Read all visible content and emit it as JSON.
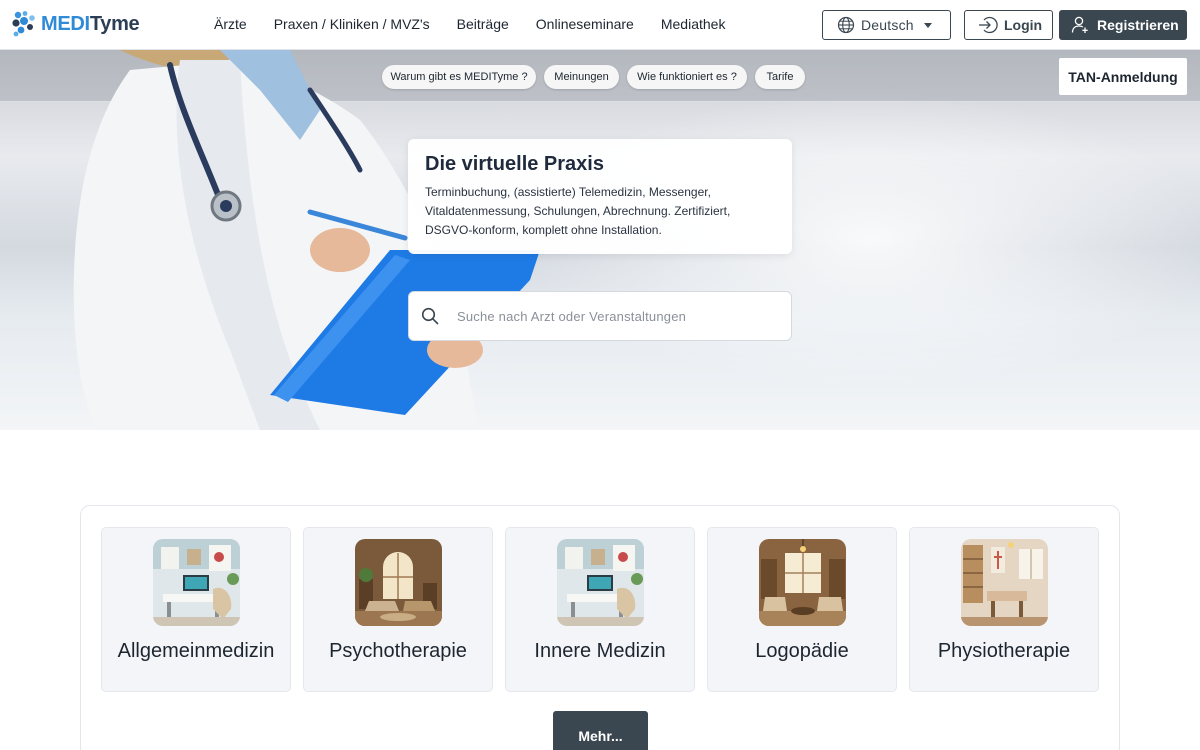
{
  "brand": {
    "logo_part1": "MEDI",
    "logo_part2": "Tyme",
    "colors": {
      "medi": "#2f8ad8",
      "tyme": "#2c3e55",
      "dark_button": "#3a4650"
    }
  },
  "nav": {
    "items": [
      {
        "label": "Ärzte"
      },
      {
        "label": "Praxen / Kliniken / MVZ's"
      },
      {
        "label": "Beiträge"
      },
      {
        "label": "Onlineseminare"
      },
      {
        "label": "Mediathek"
      }
    ]
  },
  "header_actions": {
    "language": {
      "selected": "Deutsch",
      "icon": "globe-icon"
    },
    "login_label": "Login",
    "login_icon": "login-arrow-icon",
    "register_label": "Registrieren",
    "register_icon": "add-user-icon"
  },
  "hero": {
    "pills": [
      {
        "label": "Warum gibt es MEDITyme ?"
      },
      {
        "label": "Meinungen"
      },
      {
        "label": "Wie funktioniert es ?"
      },
      {
        "label": "Tarife"
      }
    ],
    "tan_button_label": "TAN-Anmeldung",
    "card": {
      "title": "Die virtuelle Praxis",
      "text": "Terminbuchung, (assistierte) Telemedizin, Messenger, Vitaldatenmessung, Schulungen, Abrechnung. Zertifiziert, DSGVO-konform, komplett ohne Installation."
    },
    "search": {
      "placeholder": "Suche nach Arzt oder Veranstaltungen",
      "value": "",
      "icon": "search-icon"
    }
  },
  "categories": {
    "items": [
      {
        "label": "Allgemeinmedizin"
      },
      {
        "label": "Psychotherapie"
      },
      {
        "label": "Innere Medizin"
      },
      {
        "label": "Logopädie"
      },
      {
        "label": "Physiotherapie"
      }
    ],
    "more_label": "Mehr..."
  }
}
